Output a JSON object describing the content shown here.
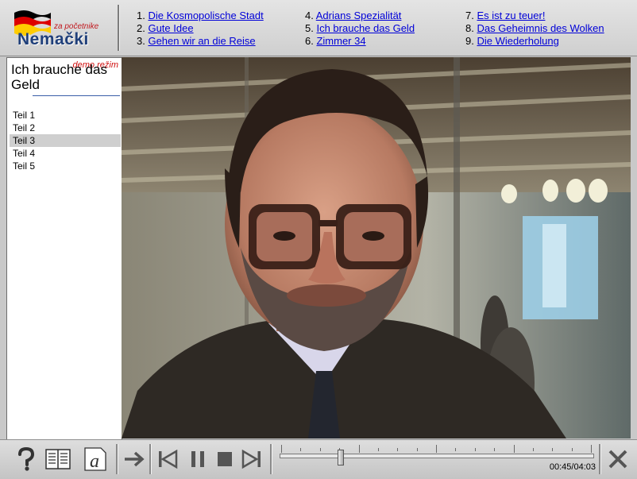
{
  "logo": {
    "subtitle": "za početnike",
    "title": "Nemački",
    "flag_colors": [
      "#000000",
      "#dd0000",
      "#ffcc00"
    ]
  },
  "chapters": [
    {
      "num": "1.",
      "label": "Die Kosmopolische Stadt"
    },
    {
      "num": "2.",
      "label": "Gute Idee"
    },
    {
      "num": "3.",
      "label": "Gehen wir an die Reise"
    },
    {
      "num": "4.",
      "label": "Adrians Spezialität"
    },
    {
      "num": "5.",
      "label": "Ich brauche das Geld"
    },
    {
      "num": "6.",
      "label": "Zimmer 34"
    },
    {
      "num": "7.",
      "label": "Es ist zu teuer!"
    },
    {
      "num": "8.",
      "label": "Das Geheimnis des Wolken"
    },
    {
      "num": "9.",
      "label": "Die Wiederholung"
    }
  ],
  "panel": {
    "demo_label": "demo režim",
    "lesson_title": "Ich brauche das Geld",
    "parts": [
      "Teil 1",
      "Teil 2",
      "Teil 3",
      "Teil 4",
      "Teil 5"
    ],
    "selected_part": 2
  },
  "player": {
    "time": "00:45/04:03",
    "position_fraction": 0.185,
    "buttons": {
      "help": "help-icon",
      "dictionary": "book-icon",
      "text": "text-a-icon",
      "next": "arrow-right-icon",
      "rewind": "skip-back-icon",
      "pause": "pause-icon",
      "stop": "stop-icon",
      "forward": "skip-forward-icon",
      "close": "close-icon"
    }
  },
  "colors": {
    "link": "#0000d8",
    "demo": "#d01010",
    "selected_row": "#cfcfcf"
  }
}
